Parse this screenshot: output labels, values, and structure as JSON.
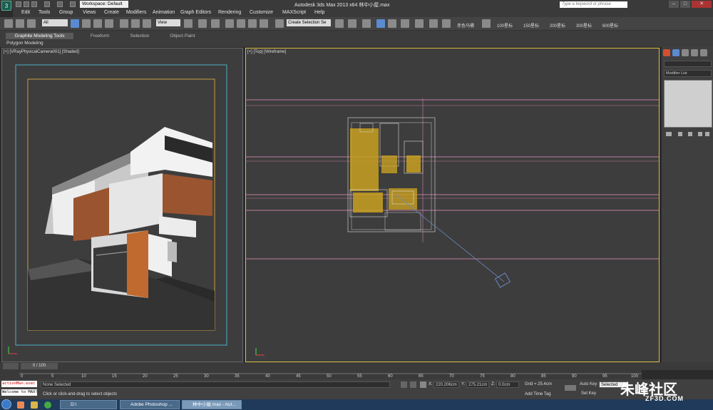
{
  "window": {
    "title": "Autodesk 3ds Max  2013 x64     林中小屋.max",
    "workspace": "Workspace: Default",
    "search_placeholder": "Type a keyword or phrase"
  },
  "menu": [
    "Edit",
    "Tools",
    "Group",
    "Views",
    "Create",
    "Modifiers",
    "Animation",
    "Graph Editors",
    "Rendering",
    "Customize",
    "MAXScript",
    "Help"
  ],
  "toolbar": {
    "filter": "All",
    "ref_coord": "View",
    "named_selection": "Create Selection Se",
    "render_presets": [
      "赤色马桶",
      "100星标",
      "150星标",
      "200星标",
      "300星标",
      "600星标"
    ]
  },
  "ribbon": {
    "tabs": [
      "Graphite Modeling Tools",
      "Freeform",
      "Selection",
      "Object Paint"
    ],
    "panel_label": "Polygon Modeling"
  },
  "viewports": {
    "left_label": "[+] [VRayPhysicalCamera001] [Shaded]",
    "right_label": "[+] [Top] [Wireframe]"
  },
  "command_panel": {
    "modifier_list": "Modifier List"
  },
  "timeline": {
    "slider": "0 / 100",
    "ticks": [
      "0",
      "5",
      "10",
      "15",
      "20",
      "25",
      "30",
      "35",
      "40",
      "45",
      "50",
      "55",
      "60",
      "65",
      "70",
      "75",
      "80",
      "85",
      "90",
      "95",
      "100"
    ]
  },
  "status": {
    "script_line1": "actionMan.exec",
    "script_line2": "Welcome to MAX!",
    "selection": "None Selected",
    "prompt": "Click or click-and-drag to select objects",
    "x_label": "X:",
    "x": "220.206cm",
    "y_label": "Y:",
    "y": "275.21cm",
    "z_label": "Z:",
    "z": "0.0cm",
    "grid": "Grid = 25.4cm",
    "add_time_tag": "Add Time Tag",
    "auto_key": "Auto Key",
    "set_key": "Set Key",
    "key_filter": "Selected"
  },
  "taskbar": {
    "items": [
      "D:\\",
      "Adobe Photoshop ...",
      "林中小屋.max - Aut..."
    ]
  },
  "watermark": {
    "line1": "朱峰社区",
    "line2": "ZF3D.COM"
  }
}
